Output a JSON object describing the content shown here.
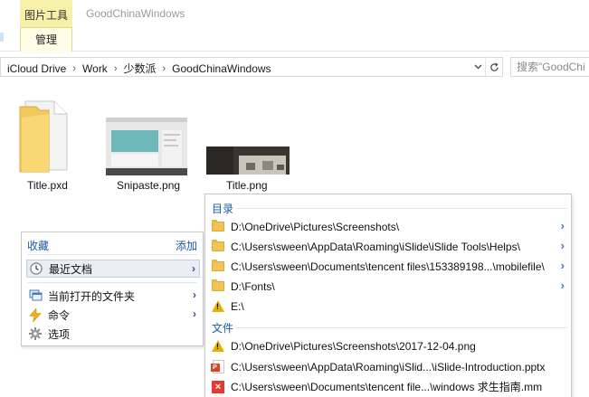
{
  "ribbon": {
    "context_tab_title": "图片工具",
    "context_tab_sub": "管理",
    "window_title": "GoodChinaWindows"
  },
  "address_bar": {
    "crumbs": [
      "iCloud Drive",
      "Work",
      "少数派",
      "GoodChinaWindows"
    ],
    "search_placeholder": "搜索\"GoodChi"
  },
  "files": [
    {
      "name": "Title.pxd",
      "icon": "pxd-file-icon"
    },
    {
      "name": "Snipaste.png",
      "icon": "image-thumbnail"
    },
    {
      "name": "Title.png",
      "icon": "image-thumbnail"
    }
  ],
  "left_panel": {
    "header": "收藏",
    "add_label": "添加",
    "items": [
      {
        "label": "最近文档",
        "icon": "clock-icon",
        "selected": true
      },
      {
        "label": "当前打开的文件夹",
        "icon": "windows-icon"
      },
      {
        "label": "命令",
        "icon": "lightning-icon"
      },
      {
        "label": "选项",
        "icon": "gear-icon"
      }
    ]
  },
  "right_panel": {
    "dirs_header": "目录",
    "files_header": "文件",
    "dirs": [
      {
        "path": "D:\\OneDrive\\Pictures\\Screenshots\\",
        "icon": "folder-icon"
      },
      {
        "path": "C:\\Users\\sween\\AppData\\Roaming\\iSlide\\iSlide Tools\\Helps\\",
        "icon": "folder-icon"
      },
      {
        "path": "C:\\Users\\sween\\Documents\\tencent files\\153389198...\\mobilefile\\",
        "icon": "folder-icon"
      },
      {
        "path": "D:\\Fonts\\",
        "icon": "folder-icon"
      },
      {
        "path": "E:\\",
        "icon": "warning-icon"
      }
    ],
    "files": [
      {
        "path": "D:\\OneDrive\\Pictures\\Screenshots\\2017-12-04.png",
        "icon": "warning-icon"
      },
      {
        "path": "C:\\Users\\sween\\AppData\\Roaming\\iSlid...\\iSlide-Introduction.pptx",
        "icon": "powerpoint-icon"
      },
      {
        "path": "C:\\Users\\sween\\Documents\\tencent file...\\windows 求生指南.mm",
        "icon": "mindmap-icon"
      }
    ]
  },
  "colors": {
    "context_tab": "#f6f0a8",
    "section_header": "#1c5aa6",
    "folder": "#f2c456",
    "warning": "#e8b100"
  }
}
